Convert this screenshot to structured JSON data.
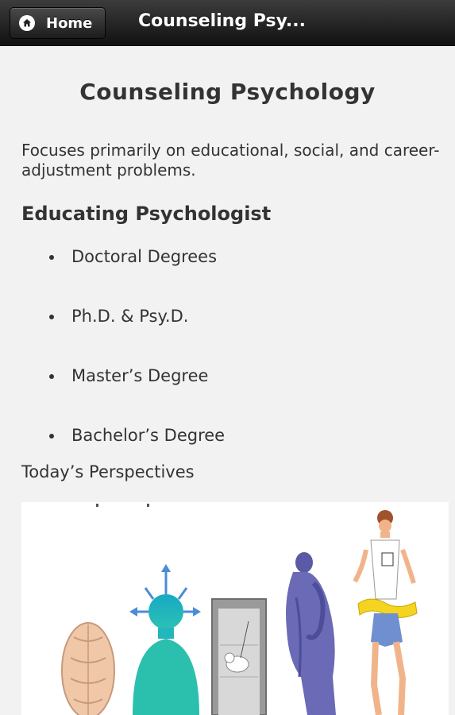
{
  "header": {
    "home_label": "Home",
    "title": "Counseling Psy..."
  },
  "main": {
    "title": "Counseling Psychology",
    "intro": "Focuses primarily on educational, social, and career-adjustment problems.",
    "section_heading": "Educating Psychologist",
    "degrees": [
      "Doctoral Degrees",
      "Ph.D. & Psy.D.",
      "Master’s Degree",
      "Bachelor’s Degree"
    ],
    "perspectives_label": "Today’s Perspectives"
  },
  "colors": {
    "header_bg": "#1a1a1a",
    "page_bg": "#f2f2f2",
    "text": "#333333"
  },
  "icons": {
    "home": "home-icon"
  }
}
